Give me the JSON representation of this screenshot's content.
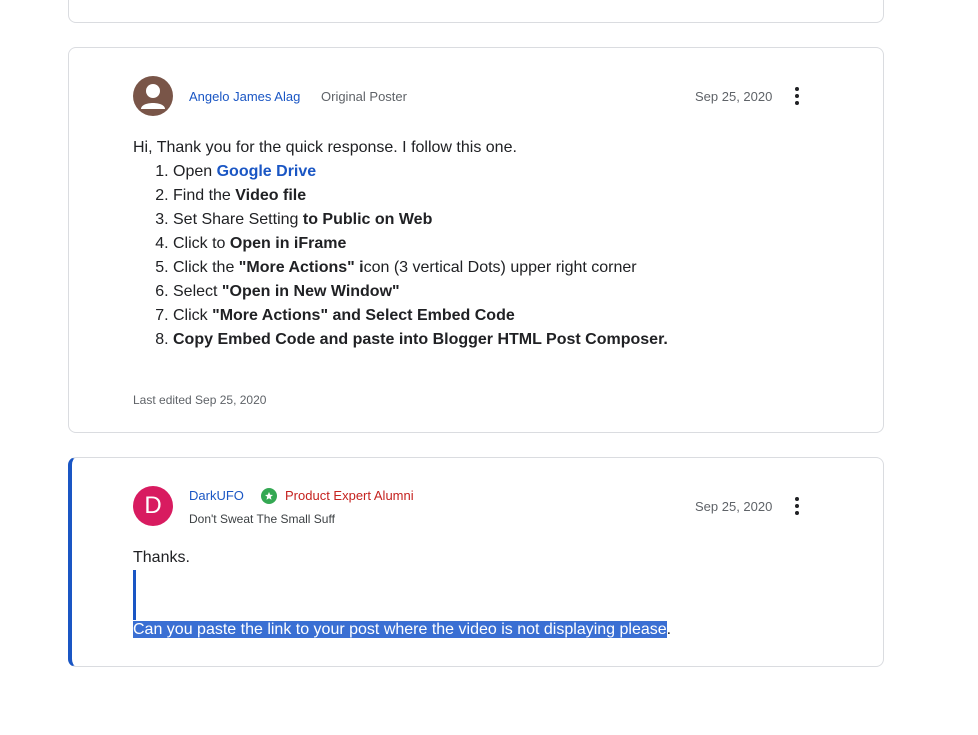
{
  "post1": {
    "author": "Angelo James Alag",
    "role": "Original Poster",
    "date": "Sep 25, 2020",
    "intro": "Hi, Thank you for the quick response. I follow this one.",
    "steps": [
      {
        "pre": "Open ",
        "link": "Google Drive"
      },
      {
        "pre": "Find the ",
        "bold": "Video file"
      },
      {
        "pre": "Set Share Setting ",
        "bold": "to Public on Web"
      },
      {
        "pre": "Click to ",
        "bold": "Open in iFrame"
      },
      {
        "pre": "Click the ",
        "bold": "\"More Actions\" i",
        "post": "con (3 vertical Dots) upper right corner"
      },
      {
        "pre": "Select ",
        "bold": "\"Open in New Window\""
      },
      {
        "pre": "Click ",
        "bold": "\"More Actions\" and Select Embed Code"
      },
      {
        "bold": "Copy Embed Code and paste into Blogger HTML Post Composer."
      }
    ],
    "edited": "Last edited Sep 25, 2020"
  },
  "post2": {
    "avatar_letter": "D",
    "author": "DarkUFO",
    "badge": "Product Expert Alumni",
    "tagline": "Don't Sweat The Small Suff",
    "date": "Sep 25, 2020",
    "text1": "Thanks.",
    "text2_selected": "Can you paste the link to your post where the video is not displaying please",
    "text2_tail": "."
  },
  "icons": {
    "more": "more-vertical-icon",
    "avatar": "person-avatar-icon",
    "badge": "expert-badge-icon"
  },
  "colors": {
    "link": "#1a56c4",
    "badge_text": "#c5221f",
    "selection": "#3a6fd3",
    "avatar_letter_bg": "#d81b60"
  }
}
